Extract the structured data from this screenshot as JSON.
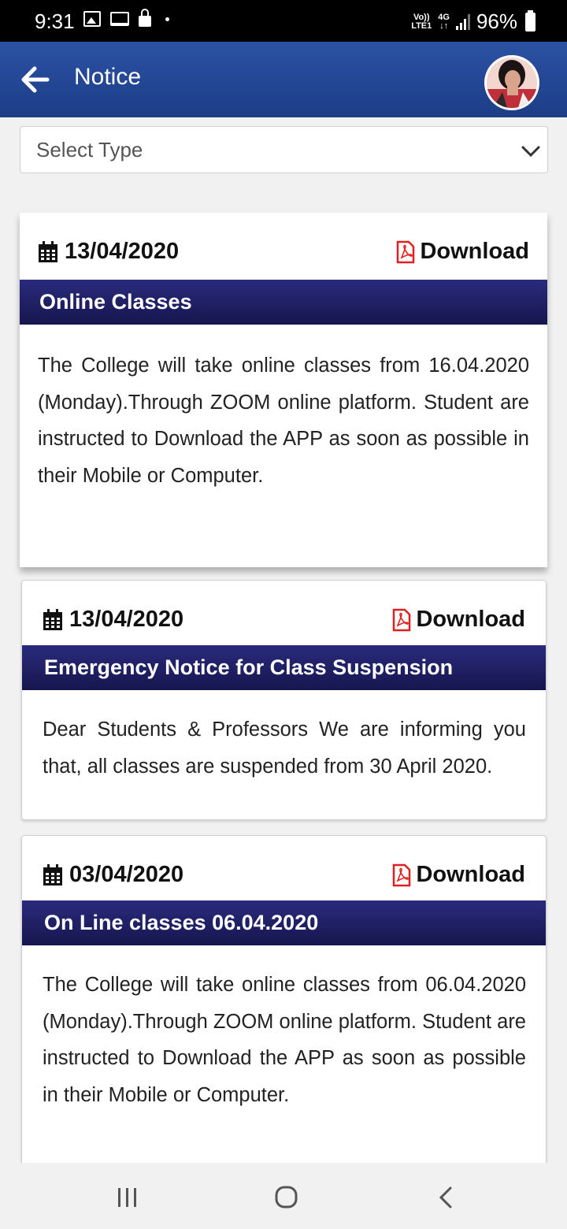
{
  "status_bar": {
    "time": "9:31",
    "net_top": "Vo))",
    "net_bottom": "LTE1",
    "net_type": "4G",
    "battery": "96%"
  },
  "app_bar": {
    "title": "Notice"
  },
  "filter": {
    "select_label": "Select Type"
  },
  "notices": [
    {
      "date": "13/04/2020",
      "download_label": "Download",
      "title": "Online Classes",
      "body": "The College will take online classes from 16.04.2020 (Monday).Through ZOOM online platform. Student are instructed to Download the APP as soon as possible in their Mobile or Computer."
    },
    {
      "date": "13/04/2020",
      "download_label": "Download",
      "title": "Emergency Notice for Class Suspension",
      "body": "Dear Students & Professors We are informing you that, all classes are suspended from 30 April 2020."
    },
    {
      "date": "03/04/2020",
      "download_label": "Download",
      "title": "On Line classes 06.04.2020",
      "body": "The College will take online classes from 06.04.2020 (Monday).Through ZOOM online platform. Student are instructed to Download the APP as soon as possible in their Mobile or Computer."
    }
  ],
  "colors": {
    "app_bar": "#2549a0",
    "title_band": "#1f1f66",
    "pdf_red": "#e02020"
  }
}
